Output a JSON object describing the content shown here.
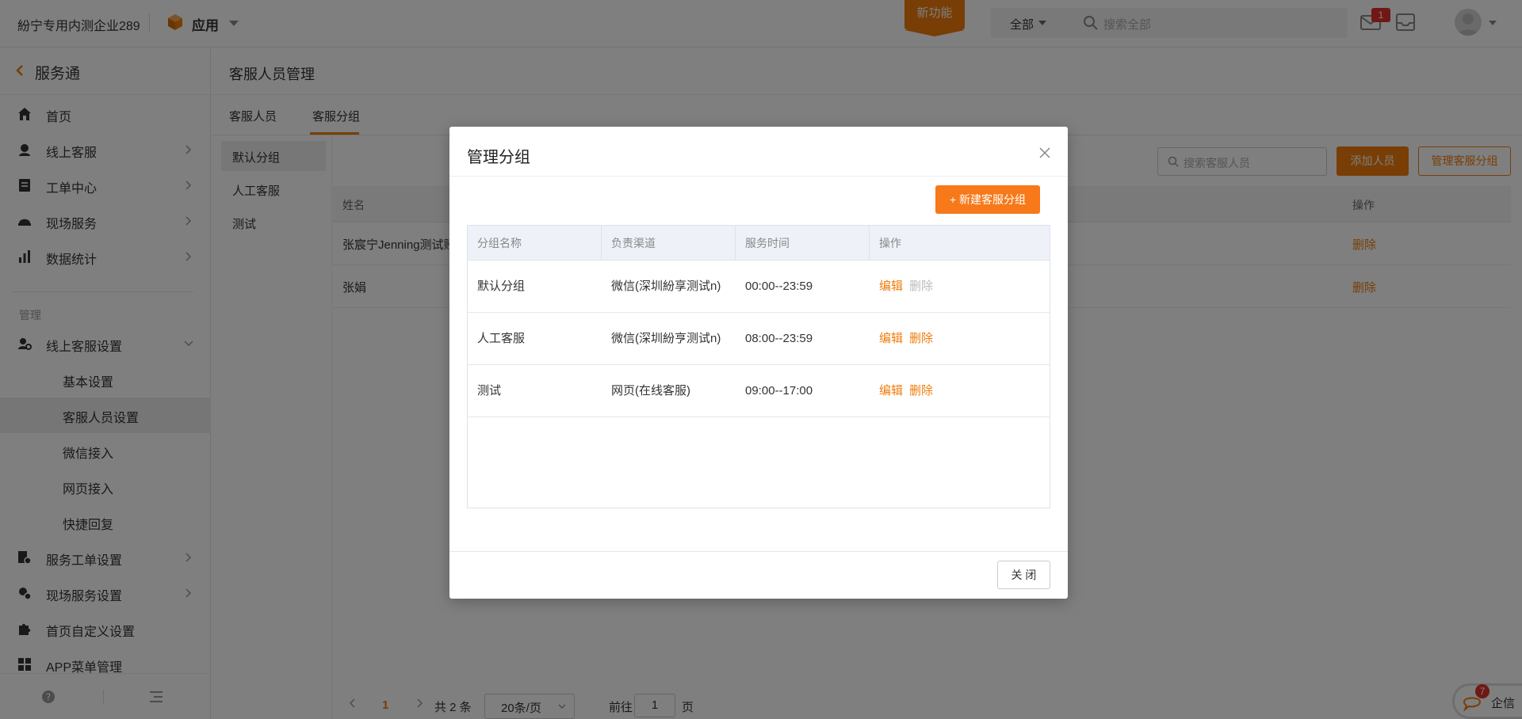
{
  "topbar": {
    "company": "紛宁专用内测企业289",
    "app_label": "应用",
    "new_feature": "新功能",
    "search_scope": "全部",
    "search_placeholder": "搜索全部",
    "mail_badge": "1",
    "brand_color": "#f07c0c"
  },
  "sidebar": {
    "title": "服务通",
    "items": [
      {
        "label": "首页",
        "icon": "home-icon"
      },
      {
        "label": "线上客服",
        "icon": "headset-icon"
      },
      {
        "label": "工单中心",
        "icon": "ticket-icon"
      },
      {
        "label": "现场服务",
        "icon": "helmet-icon"
      },
      {
        "label": "数据统计",
        "icon": "bar-chart-icon"
      }
    ],
    "section_label": "管理",
    "manage_items": [
      {
        "label": "线上客服设置",
        "icon": "cs-settings-icon"
      },
      {
        "label": "服务工单设置",
        "icon": "ticket-settings-icon"
      },
      {
        "label": "现场服务设置",
        "icon": "field-settings-icon"
      },
      {
        "label": "首页自定义设置",
        "icon": "puzzle-icon"
      },
      {
        "label": "APP菜单管理",
        "icon": "grid-icon"
      }
    ],
    "sub_items": [
      "基本设置",
      "客服人员设置",
      "微信接入",
      "网页接入",
      "快捷回复"
    ]
  },
  "main": {
    "title": "客服人员管理",
    "tabs": [
      "客服人员",
      "客服分组"
    ],
    "groups": [
      "默认分组",
      "人工客服",
      "测试"
    ],
    "search_placeholder": "搜索客服人员",
    "add_button": "添加人员",
    "manage_button": "管理客服分组",
    "table": {
      "col_name": "姓名",
      "col_op": "操作",
      "rows": [
        {
          "name": "张宸宁Jenning测试账",
          "op": "删除"
        },
        {
          "name": "张娟",
          "op": "删除"
        }
      ]
    },
    "pager": {
      "current": "1",
      "total": "共 2 条",
      "page_size": "20条/页",
      "goto": "前往",
      "goto_value": "1",
      "unit": "页"
    }
  },
  "qixin": {
    "label": "企信",
    "badge": "7"
  },
  "modal": {
    "title": "管理分组",
    "new_button": "+ 新建客服分组",
    "columns": [
      "分组名称",
      "负责渠道",
      "服务时间",
      "操作"
    ],
    "rows": [
      {
        "name": "默认分组",
        "channel": "微信(深圳紛享测试n)",
        "time": "00:00--23:59",
        "edit": "编辑",
        "delete": "删除",
        "delete_disabled": true
      },
      {
        "name": "人工客服",
        "channel": "微信(深圳紛亨测试n)",
        "time": "08:00--23:59",
        "edit": "编辑",
        "delete": "删除",
        "delete_disabled": false
      },
      {
        "name": "测试",
        "channel": "网页(在线客服)",
        "time": "09:00--17:00",
        "edit": "编辑",
        "delete": "删除",
        "delete_disabled": false
      }
    ],
    "close_button": "关 闭"
  }
}
